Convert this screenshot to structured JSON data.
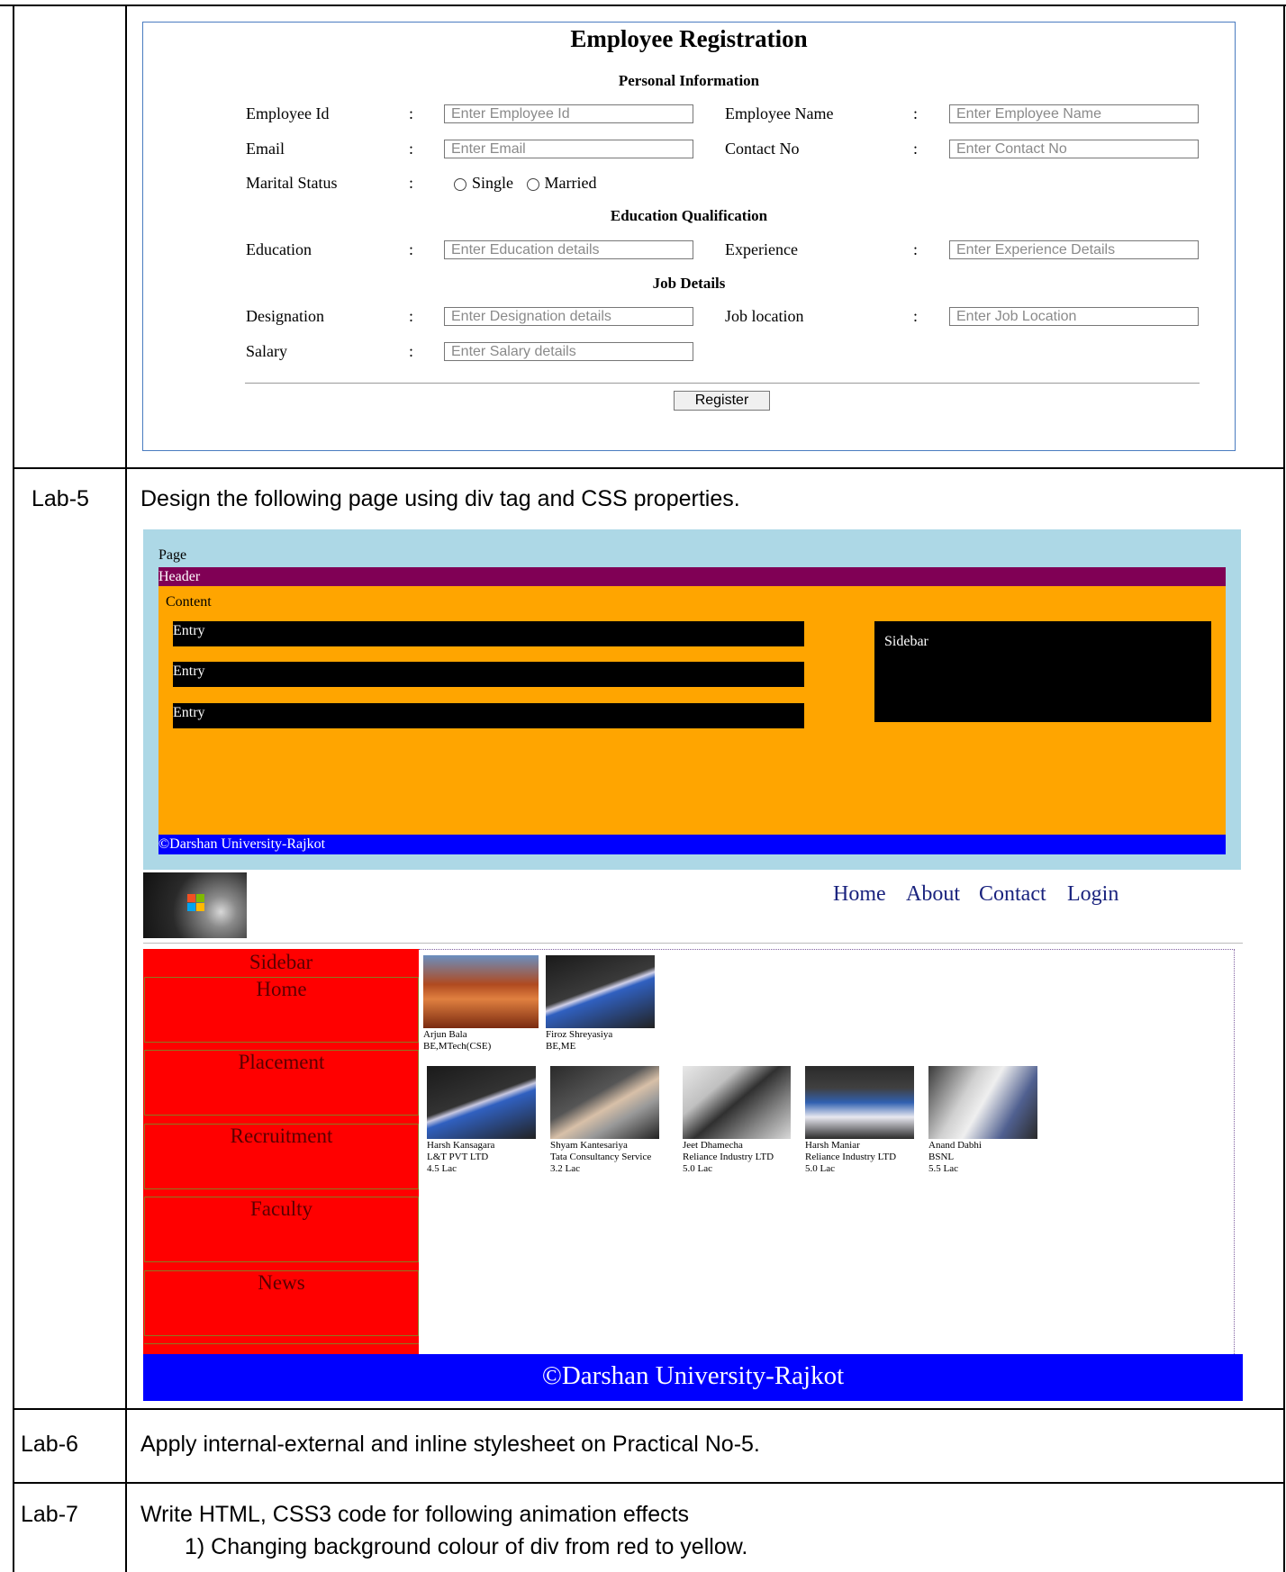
{
  "form": {
    "title": "Employee Registration",
    "sec_personal": "Personal Information",
    "sec_education": "Education Qualification",
    "sec_job": "Job Details",
    "colon": ":",
    "fields": {
      "emp_id": {
        "label": "Employee Id",
        "placeholder": "Enter Employee Id"
      },
      "emp_name": {
        "label": "Employee Name",
        "placeholder": "Enter Employee Name"
      },
      "email": {
        "label": "Email",
        "placeholder": "Enter Email"
      },
      "contact": {
        "label": "Contact No",
        "placeholder": "Enter Contact No"
      },
      "marital": {
        "label": "Marital Status",
        "opt1": "Single",
        "opt2": "Married"
      },
      "education": {
        "label": "Education",
        "placeholder": "Enter Education details"
      },
      "experience": {
        "label": "Experience",
        "placeholder": "Enter Experience Details"
      },
      "designation": {
        "label": "Designation",
        "placeholder": "Enter Designation details"
      },
      "job_location": {
        "label": "Job location",
        "placeholder": "Enter Job Location"
      },
      "salary": {
        "label": "Salary",
        "placeholder": "Enter Salary details"
      }
    },
    "register_label": "Register"
  },
  "labs": {
    "lab5": {
      "num": "Lab-5",
      "text": "Design the following page using div tag and CSS properties."
    },
    "lab6": {
      "num": "Lab-6",
      "text": "Apply internal-external and inline stylesheet on Practical No-5."
    },
    "lab7": {
      "num": "Lab-7",
      "text": "Write HTML, CSS3 code for following animation effects",
      "item1": "1)  Changing background colour of div from red to yellow."
    }
  },
  "layout1": {
    "page": "Page",
    "header": "Header",
    "content": "Content",
    "entries": [
      "Entry",
      "Entry",
      "Entry"
    ],
    "sidebar": "Sidebar",
    "footer": "©Darshan University-Rajkot"
  },
  "layout2": {
    "nav": [
      "Home",
      "About",
      "Contact",
      "Login"
    ],
    "sidebar_title": "Sidebar",
    "sidebar_items": [
      "Home",
      "Placement",
      "Recruitment",
      "Faculty",
      "News"
    ],
    "row1": [
      {
        "name": "Arjun Bala",
        "line2": "BE,MTech(CSE)"
      },
      {
        "name": "Firoz Shreyasiya",
        "line2": "BE,ME"
      }
    ],
    "row2": [
      {
        "name": "Harsh Kansagara",
        "line2": "L&T PVT LTD",
        "line3": "4.5 Lac"
      },
      {
        "name": "Shyam Kantesariya",
        "line2": "Tata Consultancy Service",
        "line3": "3.2 Lac"
      },
      {
        "name": "Jeet Dhamecha",
        "line2": "Reliance Industry LTD",
        "line3": "5.0 Lac"
      },
      {
        "name": "Harsh Maniar",
        "line2": "Reliance Industry LTD",
        "line3": "5.0 Lac"
      },
      {
        "name": "Anand Dabhi",
        "line2": "BSNL",
        "line3": "5.5 Lac"
      }
    ],
    "footer": "©Darshan University-Rajkot"
  },
  "colors": {
    "form_border": "#4a7cc0",
    "page_bg": "#add8e6",
    "header_bg": "#800055",
    "content_bg": "#ffa500",
    "entry_bg": "#000000",
    "footer_bg": "#0000ff",
    "sidebar_red": "#ff0000",
    "nav_link": "#1a237e"
  }
}
